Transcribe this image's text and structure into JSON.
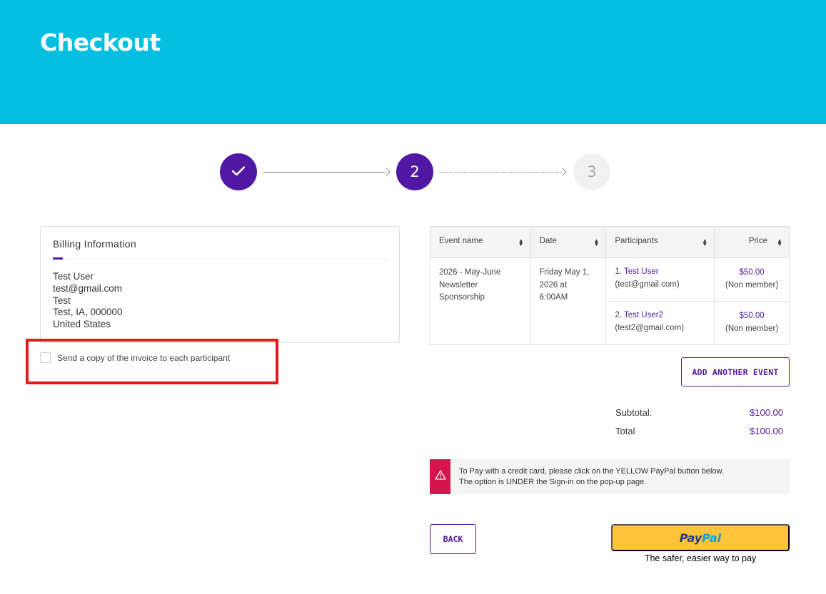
{
  "page": {
    "title": "Checkout"
  },
  "stepper": {
    "steps": [
      {
        "state": "done",
        "label": "✓"
      },
      {
        "state": "active",
        "label": "2"
      },
      {
        "state": "pending",
        "label": "3"
      }
    ]
  },
  "billing": {
    "heading": "Billing Information",
    "name": "Test User",
    "email": "test@gmail.com",
    "company": "Test",
    "city_line": "Test, IA, 000000",
    "country": "United States"
  },
  "copy_invoice": {
    "label": "Send a copy of the invoice to each participant",
    "checked": false
  },
  "table": {
    "headers": [
      "Event name",
      "Date",
      "Participants",
      "Price"
    ],
    "event": {
      "name": "2026 - May-June Newsletter Sponsorship",
      "date": "Friday May 1, 2026 at 6:00AM"
    },
    "participants": [
      {
        "index": "1.",
        "name": "Test User",
        "email": "(test@gmail.com)",
        "price": "$50.00",
        "tier": "(Non member)"
      },
      {
        "index": "2.",
        "name": "Test User2",
        "email": "(test2@gmail.com)",
        "price": "$50.00",
        "tier": "(Non member)"
      }
    ]
  },
  "buttons": {
    "add_event": "ADD ANOTHER EVENT",
    "back": "BACK"
  },
  "totals": {
    "subtotal_label": "Subtotal:",
    "subtotal": "$100.00",
    "total_label": "Total",
    "total": "$100.00"
  },
  "notice": {
    "line1": "To Pay with a credit card, please click on the YELLOW PayPal button below.",
    "line2": "The option is UNDER the Sign-in on the pop-up page."
  },
  "paypal": {
    "brand_pay": "Pay",
    "brand_pal": "Pal",
    "tagline": "The safer, easier way to pay"
  },
  "colors": {
    "hero": "#04bfe0",
    "accent": "#5119a3",
    "alert": "#d4144a",
    "paypal": "#ffc439",
    "highlight": "#e3191b"
  }
}
